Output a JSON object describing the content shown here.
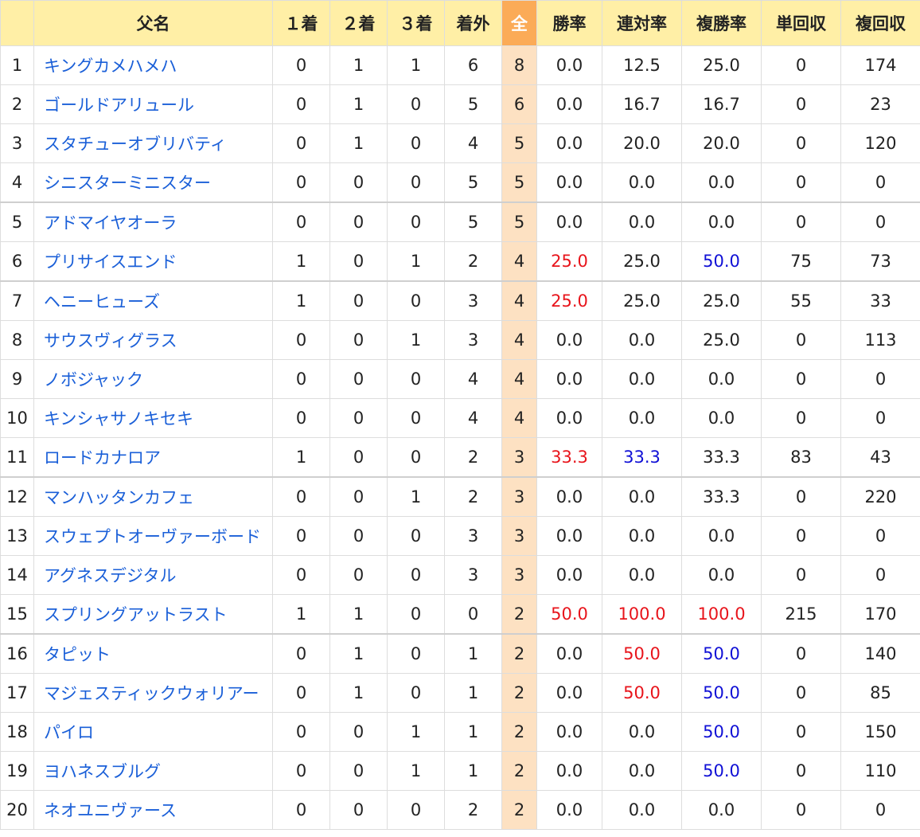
{
  "table": {
    "headers": {
      "rank": "",
      "name": "父名",
      "first": "１着",
      "second": "２着",
      "third": "３着",
      "outside": "着外",
      "all": "全",
      "win_rate": "勝率",
      "place_rate": "連対率",
      "show_rate": "複勝率",
      "win_return": "単回収",
      "show_return": "複回収"
    },
    "rows": [
      {
        "rank": "1",
        "name": "キングカメハメハ",
        "first": "0",
        "second": "1",
        "third": "1",
        "outside": "6",
        "all": "8",
        "win_rate": "0.0",
        "place_rate": "12.5",
        "show_rate": "25.0",
        "win_return": "0",
        "show_return": "174"
      },
      {
        "rank": "2",
        "name": "ゴールドアリュール",
        "first": "0",
        "second": "1",
        "third": "0",
        "outside": "5",
        "all": "6",
        "win_rate": "0.0",
        "place_rate": "16.7",
        "show_rate": "16.7",
        "win_return": "0",
        "show_return": "23"
      },
      {
        "rank": "3",
        "name": "スタチューオブリバティ",
        "first": "0",
        "second": "1",
        "third": "0",
        "outside": "4",
        "all": "5",
        "win_rate": "0.0",
        "place_rate": "20.0",
        "show_rate": "20.0",
        "win_return": "0",
        "show_return": "120"
      },
      {
        "rank": "4",
        "name": "シニスターミニスター",
        "first": "0",
        "second": "0",
        "third": "0",
        "outside": "5",
        "all": "5",
        "win_rate": "0.0",
        "place_rate": "0.0",
        "show_rate": "0.0",
        "win_return": "0",
        "show_return": "0"
      },
      {
        "rank": "5",
        "name": "アドマイヤオーラ",
        "first": "0",
        "second": "0",
        "third": "0",
        "outside": "5",
        "all": "5",
        "win_rate": "0.0",
        "place_rate": "0.0",
        "show_rate": "0.0",
        "win_return": "0",
        "show_return": "0"
      },
      {
        "rank": "6",
        "name": "プリサイスエンド",
        "first": "1",
        "second": "0",
        "third": "1",
        "outside": "2",
        "all": "4",
        "win_rate": "25.0",
        "place_rate": "25.0",
        "show_rate": "50.0",
        "win_return": "75",
        "show_return": "73"
      },
      {
        "rank": "7",
        "name": "ヘニーヒューズ",
        "first": "1",
        "second": "0",
        "third": "0",
        "outside": "3",
        "all": "4",
        "win_rate": "25.0",
        "place_rate": "25.0",
        "show_rate": "25.0",
        "win_return": "55",
        "show_return": "33"
      },
      {
        "rank": "8",
        "name": "サウスヴィグラス",
        "first": "0",
        "second": "0",
        "third": "1",
        "outside": "3",
        "all": "4",
        "win_rate": "0.0",
        "place_rate": "0.0",
        "show_rate": "25.0",
        "win_return": "0",
        "show_return": "113"
      },
      {
        "rank": "9",
        "name": "ノボジャック",
        "first": "0",
        "second": "0",
        "third": "0",
        "outside": "4",
        "all": "4",
        "win_rate": "0.0",
        "place_rate": "0.0",
        "show_rate": "0.0",
        "win_return": "0",
        "show_return": "0"
      },
      {
        "rank": "10",
        "name": "キンシャサノキセキ",
        "first": "0",
        "second": "0",
        "third": "0",
        "outside": "4",
        "all": "4",
        "win_rate": "0.0",
        "place_rate": "0.0",
        "show_rate": "0.0",
        "win_return": "0",
        "show_return": "0"
      },
      {
        "rank": "11",
        "name": "ロードカナロア",
        "first": "1",
        "second": "0",
        "third": "0",
        "outside": "2",
        "all": "3",
        "win_rate": "33.3",
        "place_rate": "33.3",
        "show_rate": "33.3",
        "win_return": "83",
        "show_return": "43"
      },
      {
        "rank": "12",
        "name": "マンハッタンカフェ",
        "first": "0",
        "second": "0",
        "third": "1",
        "outside": "2",
        "all": "3",
        "win_rate": "0.0",
        "place_rate": "0.0",
        "show_rate": "33.3",
        "win_return": "0",
        "show_return": "220"
      },
      {
        "rank": "13",
        "name": "スウェプトオーヴァーボード",
        "first": "0",
        "second": "0",
        "third": "0",
        "outside": "3",
        "all": "3",
        "win_rate": "0.0",
        "place_rate": "0.0",
        "show_rate": "0.0",
        "win_return": "0",
        "show_return": "0"
      },
      {
        "rank": "14",
        "name": "アグネスデジタル",
        "first": "0",
        "second": "0",
        "third": "0",
        "outside": "3",
        "all": "3",
        "win_rate": "0.0",
        "place_rate": "0.0",
        "show_rate": "0.0",
        "win_return": "0",
        "show_return": "0"
      },
      {
        "rank": "15",
        "name": "スプリングアットラスト",
        "first": "1",
        "second": "1",
        "third": "0",
        "outside": "0",
        "all": "2",
        "win_rate": "50.0",
        "place_rate": "100.0",
        "show_rate": "100.0",
        "win_return": "215",
        "show_return": "170"
      },
      {
        "rank": "16",
        "name": "タピット",
        "first": "0",
        "second": "1",
        "third": "0",
        "outside": "1",
        "all": "2",
        "win_rate": "0.0",
        "place_rate": "50.0",
        "show_rate": "50.0",
        "win_return": "0",
        "show_return": "140"
      },
      {
        "rank": "17",
        "name": "マジェスティックウォリアー",
        "first": "0",
        "second": "1",
        "third": "0",
        "outside": "1",
        "all": "2",
        "win_rate": "0.0",
        "place_rate": "50.0",
        "show_rate": "50.0",
        "win_return": "0",
        "show_return": "85"
      },
      {
        "rank": "18",
        "name": "パイロ",
        "first": "0",
        "second": "0",
        "third": "1",
        "outside": "1",
        "all": "2",
        "win_rate": "0.0",
        "place_rate": "0.0",
        "show_rate": "50.0",
        "win_return": "0",
        "show_return": "150"
      },
      {
        "rank": "19",
        "name": "ヨハネスブルグ",
        "first": "0",
        "second": "0",
        "third": "1",
        "outside": "1",
        "all": "2",
        "win_rate": "0.0",
        "place_rate": "0.0",
        "show_rate": "50.0",
        "win_return": "0",
        "show_return": "110"
      },
      {
        "rank": "20",
        "name": "ネオユニヴァース",
        "first": "0",
        "second": "0",
        "third": "0",
        "outside": "2",
        "all": "2",
        "win_rate": "0.0",
        "place_rate": "0.0",
        "show_rate": "0.0",
        "win_return": "0",
        "show_return": "0"
      }
    ],
    "highlight": {
      "win_rate": {
        "1.0": "red"
      },
      "place_rate": {
        "10": "blue",
        "14": "red",
        "15": "red",
        "16": "red"
      },
      "show_rate": {
        "5": "blue",
        "14": "red",
        "15": "blue",
        "16": "blue",
        "17": "blue",
        "18": "blue"
      }
    }
  },
  "colors": {
    "header_bg": "#ffefa6",
    "all_header_bg": "#fbab57",
    "all_cell_bg": "#fde1c2",
    "link": "#1a5fd8",
    "highlight_red": "#e8141b",
    "highlight_blue": "#1010d6",
    "border": "#dddddd"
  }
}
